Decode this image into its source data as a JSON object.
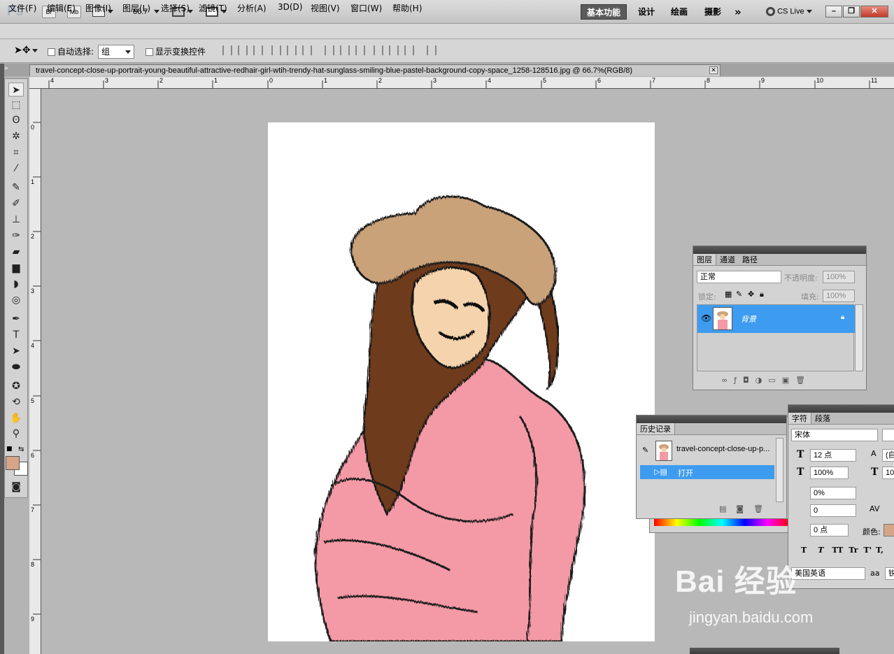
{
  "appbar": {
    "logo": "Ps",
    "bridge": "Br",
    "mini_bridge": "Mb",
    "zoom": "66.7",
    "workspaces": [
      "基本功能",
      "设计",
      "绘画",
      "摄影"
    ],
    "more": "»",
    "cslive": "CS Live"
  },
  "menu": [
    "文件(F)",
    "编辑(E)",
    "图像(I)",
    "图层(L)",
    "选择(S)",
    "滤镜(T)",
    "分析(A)",
    "3D(D)",
    "视图(V)",
    "窗口(W)",
    "帮助(H)"
  ],
  "options": {
    "auto_select_label": "自动选择:",
    "auto_select_value": "组",
    "show_transform_label": "显示变换控件"
  },
  "document": {
    "tab_title": "travel-concept-close-up-portrait-young-beautiful-attractive-redhair-girl-wtih-trendy-hat-sunglass-smiling-blue-pastel-background-copy-space_1258-128516.jpg @ 66.7%(RGB/8)"
  },
  "rulers": {
    "h_ticks": [
      "4",
      "3",
      "2",
      "1",
      "0",
      "1",
      "2",
      "3",
      "4",
      "5",
      "6",
      "7",
      "8",
      "9",
      "10",
      "11"
    ],
    "v_ticks": [
      "0",
      "1",
      "2",
      "3",
      "4",
      "5",
      "6",
      "7",
      "8",
      "9"
    ]
  },
  "layers_panel": {
    "tabs": [
      "图层",
      "通道",
      "路径"
    ],
    "blend_mode": "正常",
    "opacity_label": "不透明度:",
    "opacity_value": "100%",
    "lock_label": "锁定:",
    "fill_label": "填充:",
    "fill_value": "100%",
    "layer_name": "背景"
  },
  "history_panel": {
    "tab": "历史记录",
    "snapshot": "travel-concept-close-up-p...",
    "step": "打开"
  },
  "character_panel": {
    "tabs": [
      "字符",
      "段落"
    ],
    "font": "宋体",
    "size": "12 点",
    "leading_partial": "(自",
    "vscale": "100%",
    "hscale_partial": "100",
    "tracking_pct": "0%",
    "kerning": "0",
    "baseline": "0 点",
    "color_label": "颜色:",
    "style_buttons": [
      "T",
      "T",
      "TT",
      "Tr",
      "T'",
      "T,"
    ],
    "language": "美国英语",
    "aa_label": "aa",
    "aa_value_partial": "锐"
  },
  "colors": {
    "foreground": "#d6a587",
    "background": "#ffffff",
    "selection": "#3d9cf0",
    "workspace_active": "#5b5b5b"
  },
  "watermark": {
    "brand": "Bai 经验",
    "url": "jingyan.baidu.com"
  }
}
